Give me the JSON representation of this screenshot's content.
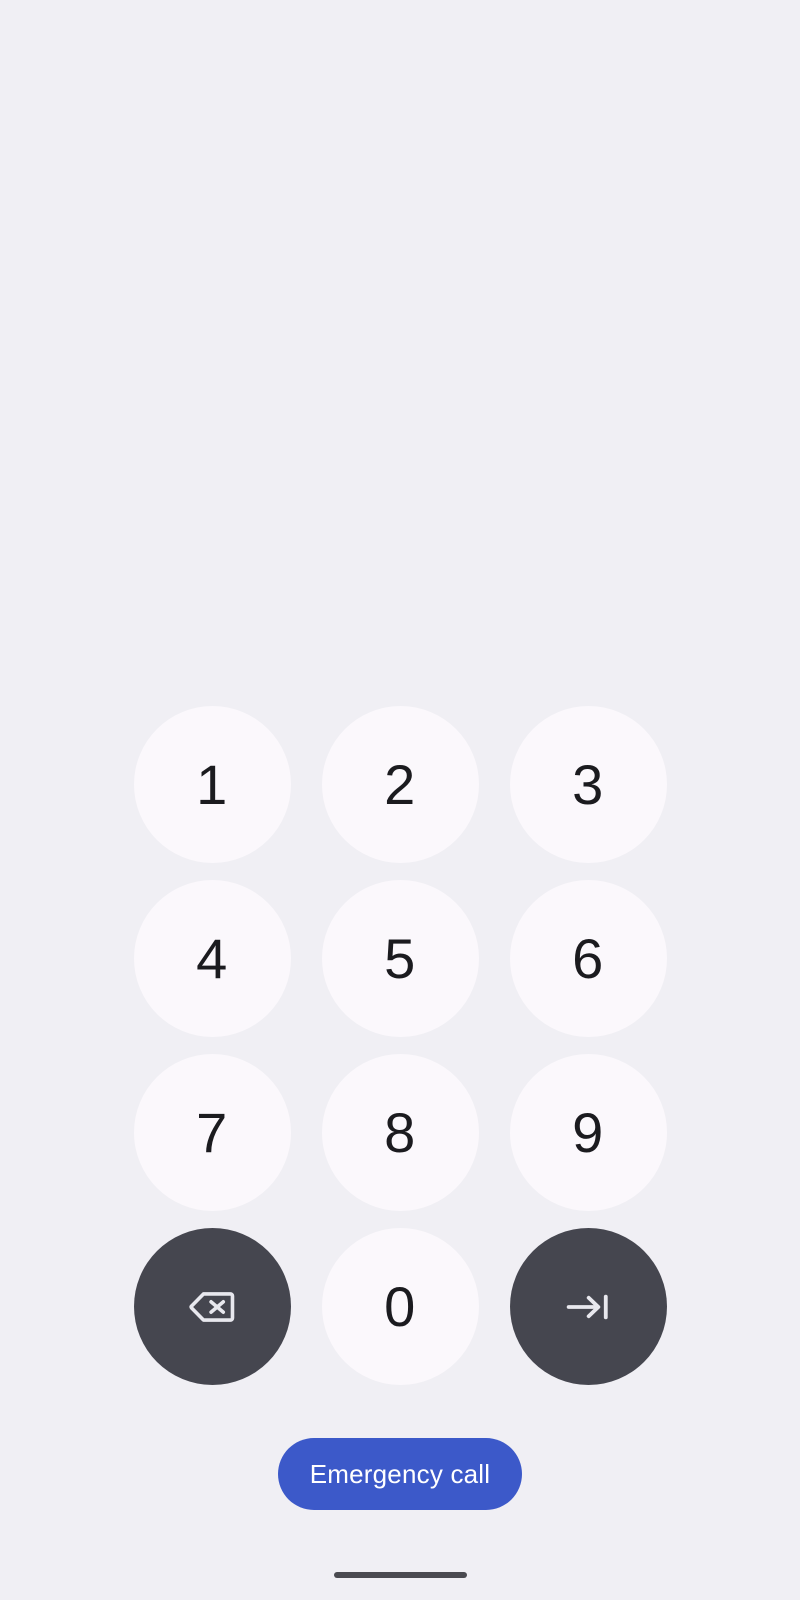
{
  "screen": {
    "name": "lock-screen-pin-entry",
    "background_color": "#F0EFF4"
  },
  "keypad": {
    "key_fill_color": "#FBF8FC",
    "key_text_color": "#1B1B1F",
    "action_fill_color": "#45464F",
    "action_icon_color": "#E8E8EE",
    "rows": [
      {
        "keys": [
          {
            "type": "digit",
            "label": "1",
            "name": "keypad-key-1"
          },
          {
            "type": "digit",
            "label": "2",
            "name": "keypad-key-2"
          },
          {
            "type": "digit",
            "label": "3",
            "name": "keypad-key-3"
          }
        ]
      },
      {
        "keys": [
          {
            "type": "digit",
            "label": "4",
            "name": "keypad-key-4"
          },
          {
            "type": "digit",
            "label": "5",
            "name": "keypad-key-5"
          },
          {
            "type": "digit",
            "label": "6",
            "name": "keypad-key-6"
          }
        ]
      },
      {
        "keys": [
          {
            "type": "digit",
            "label": "7",
            "name": "keypad-key-7"
          },
          {
            "type": "digit",
            "label": "8",
            "name": "keypad-key-8"
          },
          {
            "type": "digit",
            "label": "9",
            "name": "keypad-key-9"
          }
        ]
      },
      {
        "keys": [
          {
            "type": "action",
            "icon": "backspace-icon",
            "label": "",
            "name": "keypad-key-backspace"
          },
          {
            "type": "digit",
            "label": "0",
            "name": "keypad-key-0"
          },
          {
            "type": "action",
            "icon": "enter-icon",
            "label": "",
            "name": "keypad-key-enter"
          }
        ]
      }
    ],
    "row1": {
      "k1": "1",
      "k2": "2",
      "k3": "3"
    },
    "row2": {
      "k1": "4",
      "k2": "5",
      "k3": "6"
    },
    "row3": {
      "k1": "7",
      "k2": "8",
      "k3": "9"
    },
    "row4": {
      "k2": "0"
    }
  },
  "emergency": {
    "label": "Emergency call",
    "background_color": "#3C59C9",
    "text_color": "#FFFFFF"
  },
  "navigation": {
    "gesture_bar_color": "#4A4A50"
  }
}
